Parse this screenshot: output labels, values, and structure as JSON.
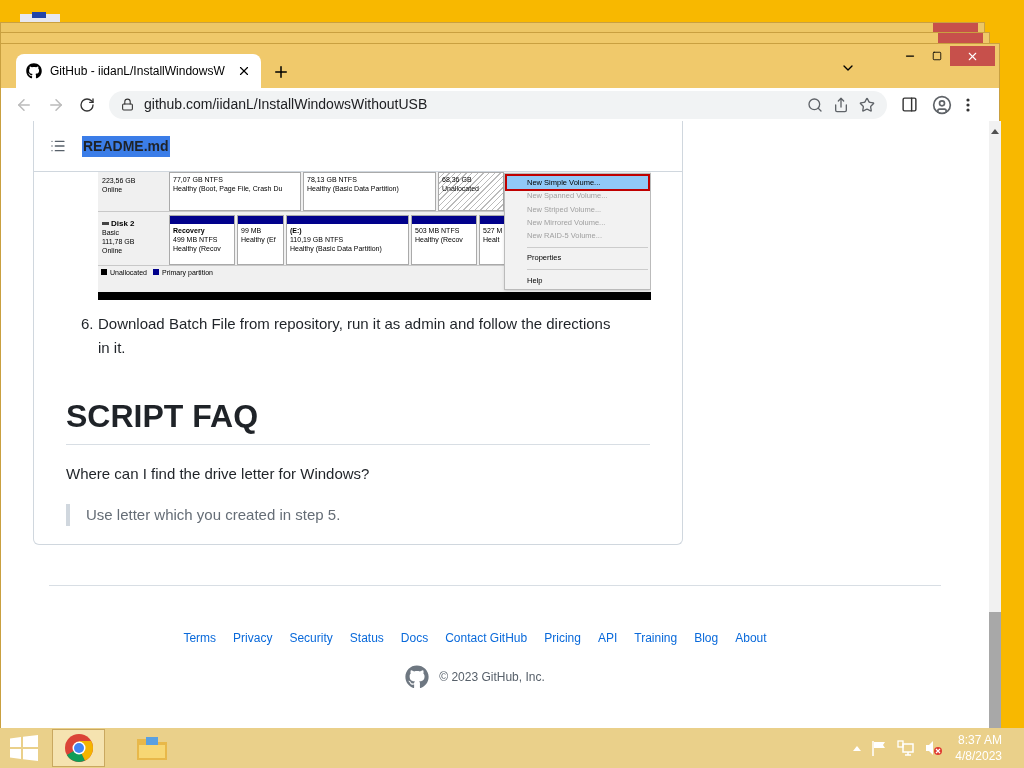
{
  "browser": {
    "tab": {
      "title": "GitHub - iidanL/InstallWindowsW",
      "selected": true
    },
    "address": "github.com/iidanL/InstallWindowsWithoutUSB"
  },
  "readme": {
    "file_name": "README.md",
    "file_name_highlighted": true,
    "disk_image": {
      "disks": [
        {
          "lines": [
            "223,56 GB",
            "Online"
          ],
          "partitions": [
            {
              "kind": "primary",
              "header": false,
              "size": "77,07 GB NTFS",
              "status": "Healthy (Boot, Page File, Crash Du"
            },
            {
              "kind": "primary",
              "header": false,
              "size": "78,13 GB NTFS",
              "status": "Healthy (Basic Data Partition)"
            },
            {
              "kind": "unallocated",
              "header": false,
              "size": "68,36 GB",
              "status": "Unallocated"
            }
          ]
        },
        {
          "name": "Disk 2",
          "lines": [
            "Basic",
            "111,78 GB",
            "Online"
          ],
          "partitions": [
            {
              "kind": "primary",
              "header": true,
              "name": "Recovery",
              "size": "499 MB NTFS",
              "status": "Healthy (Recov"
            },
            {
              "kind": "primary",
              "header": true,
              "size": "99 MB",
              "status": "Healthy (Ef"
            },
            {
              "kind": "primary",
              "header": true,
              "name": "(E:)",
              "size": "110,19 GB NTFS",
              "status": "Healthy (Basic Data Partition)"
            },
            {
              "kind": "primary",
              "header": true,
              "size": "503 MB NTFS",
              "status": "Healthy (Recov"
            },
            {
              "kind": "primary",
              "header": true,
              "size": "527 M",
              "status": "Healt"
            }
          ]
        }
      ],
      "legend": [
        {
          "label": "Unallocated",
          "color": "#000000"
        },
        {
          "label": "Primary partition",
          "color": "#00008b"
        }
      ],
      "context_menu": [
        {
          "label": "New Simple Volume...",
          "selected": true,
          "disabled": false
        },
        {
          "label": "New Spanned Volume...",
          "selected": false,
          "disabled": true
        },
        {
          "label": "New Striped Volume...",
          "selected": false,
          "disabled": true
        },
        {
          "label": "New Mirrored Volume...",
          "selected": false,
          "disabled": true
        },
        {
          "label": "New RAID-5 Volume...",
          "selected": false,
          "disabled": true
        },
        {
          "label": "Properties",
          "selected": false,
          "disabled": false
        },
        {
          "label": "Help",
          "selected": false,
          "disabled": false
        }
      ]
    },
    "steps": [
      {
        "number": "6.",
        "text": "Download Batch File from repository, run it as admin and follow the directions in it."
      }
    ],
    "heading": "SCRIPT FAQ",
    "question": "Where can I find the drive letter for Windows?",
    "answer": "Use letter which you created in step 5."
  },
  "footer": {
    "links": [
      "Terms",
      "Privacy",
      "Security",
      "Status",
      "Docs",
      "Contact GitHub",
      "Pricing",
      "API",
      "Training",
      "Blog",
      "About"
    ],
    "copyright": "© 2023 GitHub, Inc."
  },
  "taskbar": {
    "apps": [
      {
        "kind": "chrome",
        "active": true
      },
      {
        "kind": "explorer",
        "active": false
      }
    ],
    "time": "8:37 AM",
    "date": "4/8/2023"
  }
}
